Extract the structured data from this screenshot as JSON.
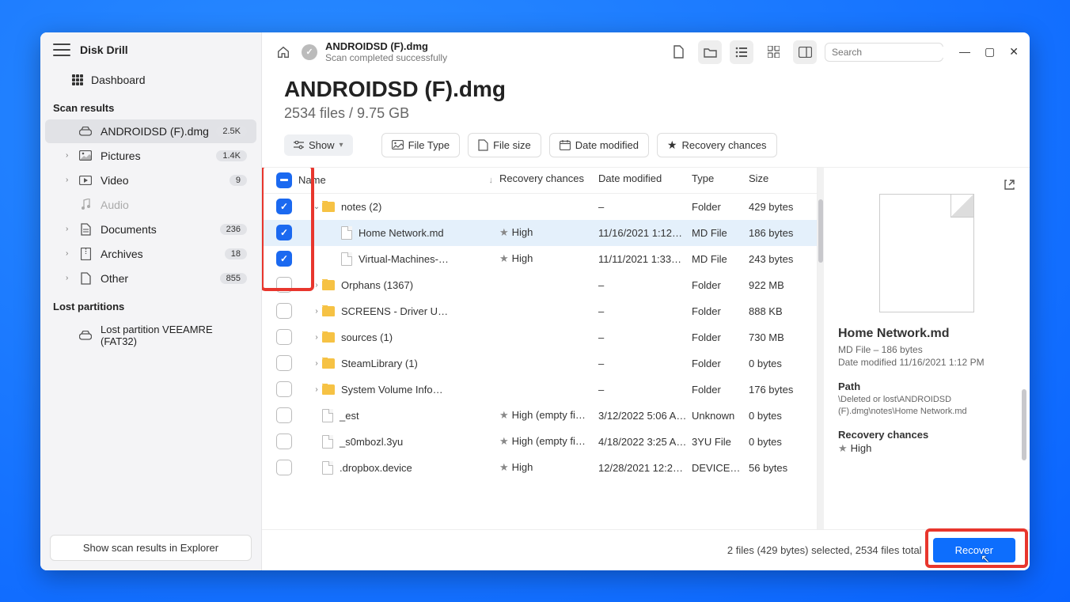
{
  "app": {
    "title": "Disk Drill"
  },
  "dashboard_label": "Dashboard",
  "sections": {
    "scan_results": "Scan results",
    "lost_partitions": "Lost partitions"
  },
  "nav": [
    {
      "label": "ANDROIDSD (F).dmg",
      "badge": "2.5K",
      "icon": "drive",
      "active": true,
      "chev": false
    },
    {
      "label": "Pictures",
      "badge": "1.4K",
      "icon": "image",
      "chev": true
    },
    {
      "label": "Video",
      "badge": "9",
      "icon": "video",
      "chev": true
    },
    {
      "label": "Audio",
      "badge": "",
      "icon": "audio",
      "chev": false,
      "muted": true
    },
    {
      "label": "Documents",
      "badge": "236",
      "icon": "doc",
      "chev": true
    },
    {
      "label": "Archives",
      "badge": "18",
      "icon": "archive",
      "chev": true
    },
    {
      "label": "Other",
      "badge": "855",
      "icon": "other",
      "chev": true
    }
  ],
  "lost_item": "Lost partition VEEAMRE (FAT32)",
  "explorer_btn": "Show scan results in Explorer",
  "topbar": {
    "title": "ANDROIDSD (F).dmg",
    "subtitle": "Scan completed successfully"
  },
  "search_placeholder": "Search",
  "heading": "ANDROIDSD (F).dmg",
  "subheading": "2534 files / 9.75 GB",
  "show_label": "Show",
  "chips": [
    "File Type",
    "File size",
    "Date modified",
    "Recovery chances"
  ],
  "columns": {
    "name": "Name",
    "rec": "Recovery chances",
    "date": "Date modified",
    "type": "Type",
    "size": "Size"
  },
  "rows": [
    {
      "cb": "checked",
      "indent": 0,
      "expand": "down",
      "kind": "folder",
      "name": "notes (2)",
      "rec": "",
      "date": "–",
      "type": "Folder",
      "size": "429 bytes"
    },
    {
      "cb": "checked",
      "indent": 1,
      "expand": "",
      "kind": "file",
      "name": "Home Network.md",
      "rec": "High",
      "date": "11/16/2021 1:12…",
      "type": "MD File",
      "size": "186 bytes",
      "star": true,
      "selected": true
    },
    {
      "cb": "checked",
      "indent": 1,
      "expand": "",
      "kind": "file",
      "name": "Virtual-Machines-…",
      "rec": "High",
      "date": "11/11/2021 1:33…",
      "type": "MD File",
      "size": "243 bytes",
      "star": true
    },
    {
      "cb": "",
      "indent": 0,
      "expand": "right",
      "kind": "folder",
      "name": "Orphans (1367)",
      "rec": "",
      "date": "–",
      "type": "Folder",
      "size": "922 MB"
    },
    {
      "cb": "",
      "indent": 0,
      "expand": "right",
      "kind": "folder",
      "name": "SCREENS - Driver U…",
      "rec": "",
      "date": "–",
      "type": "Folder",
      "size": "888 KB"
    },
    {
      "cb": "",
      "indent": 0,
      "expand": "right",
      "kind": "folder",
      "name": "sources (1)",
      "rec": "",
      "date": "–",
      "type": "Folder",
      "size": "730 MB"
    },
    {
      "cb": "",
      "indent": 0,
      "expand": "right",
      "kind": "folder",
      "name": "SteamLibrary (1)",
      "rec": "",
      "date": "–",
      "type": "Folder",
      "size": "0 bytes"
    },
    {
      "cb": "",
      "indent": 0,
      "expand": "right",
      "kind": "folder",
      "name": "System Volume Info…",
      "rec": "",
      "date": "–",
      "type": "Folder",
      "size": "176 bytes"
    },
    {
      "cb": "",
      "indent": 0,
      "expand": "",
      "kind": "file",
      "name": "_est",
      "rec": "High (empty fi…",
      "date": "3/12/2022 5:06 A…",
      "type": "Unknown",
      "size": "0 bytes",
      "star": true
    },
    {
      "cb": "",
      "indent": 0,
      "expand": "",
      "kind": "file",
      "name": "_s0mbozl.3yu",
      "rec": "High (empty fi…",
      "date": "4/18/2022 3:25 A…",
      "type": "3YU File",
      "size": "0 bytes",
      "star": true
    },
    {
      "cb": "",
      "indent": 0,
      "expand": "",
      "kind": "file",
      "name": ".dropbox.device",
      "rec": "High",
      "date": "12/28/2021 12:2…",
      "type": "DEVICE…",
      "size": "56 bytes",
      "star": true
    }
  ],
  "status": "2 files (429 bytes) selected, 2534 files total",
  "recover_label": "Recover",
  "detail": {
    "name": "Home Network.md",
    "meta1": "MD File – 186 bytes",
    "meta2": "Date modified 11/16/2021 1:12 PM",
    "path_label": "Path",
    "path": "\\Deleted or lost\\ANDROIDSD (F).dmg\\notes\\Home Network.md",
    "rec_label": "Recovery chances",
    "rec_value": "High"
  }
}
